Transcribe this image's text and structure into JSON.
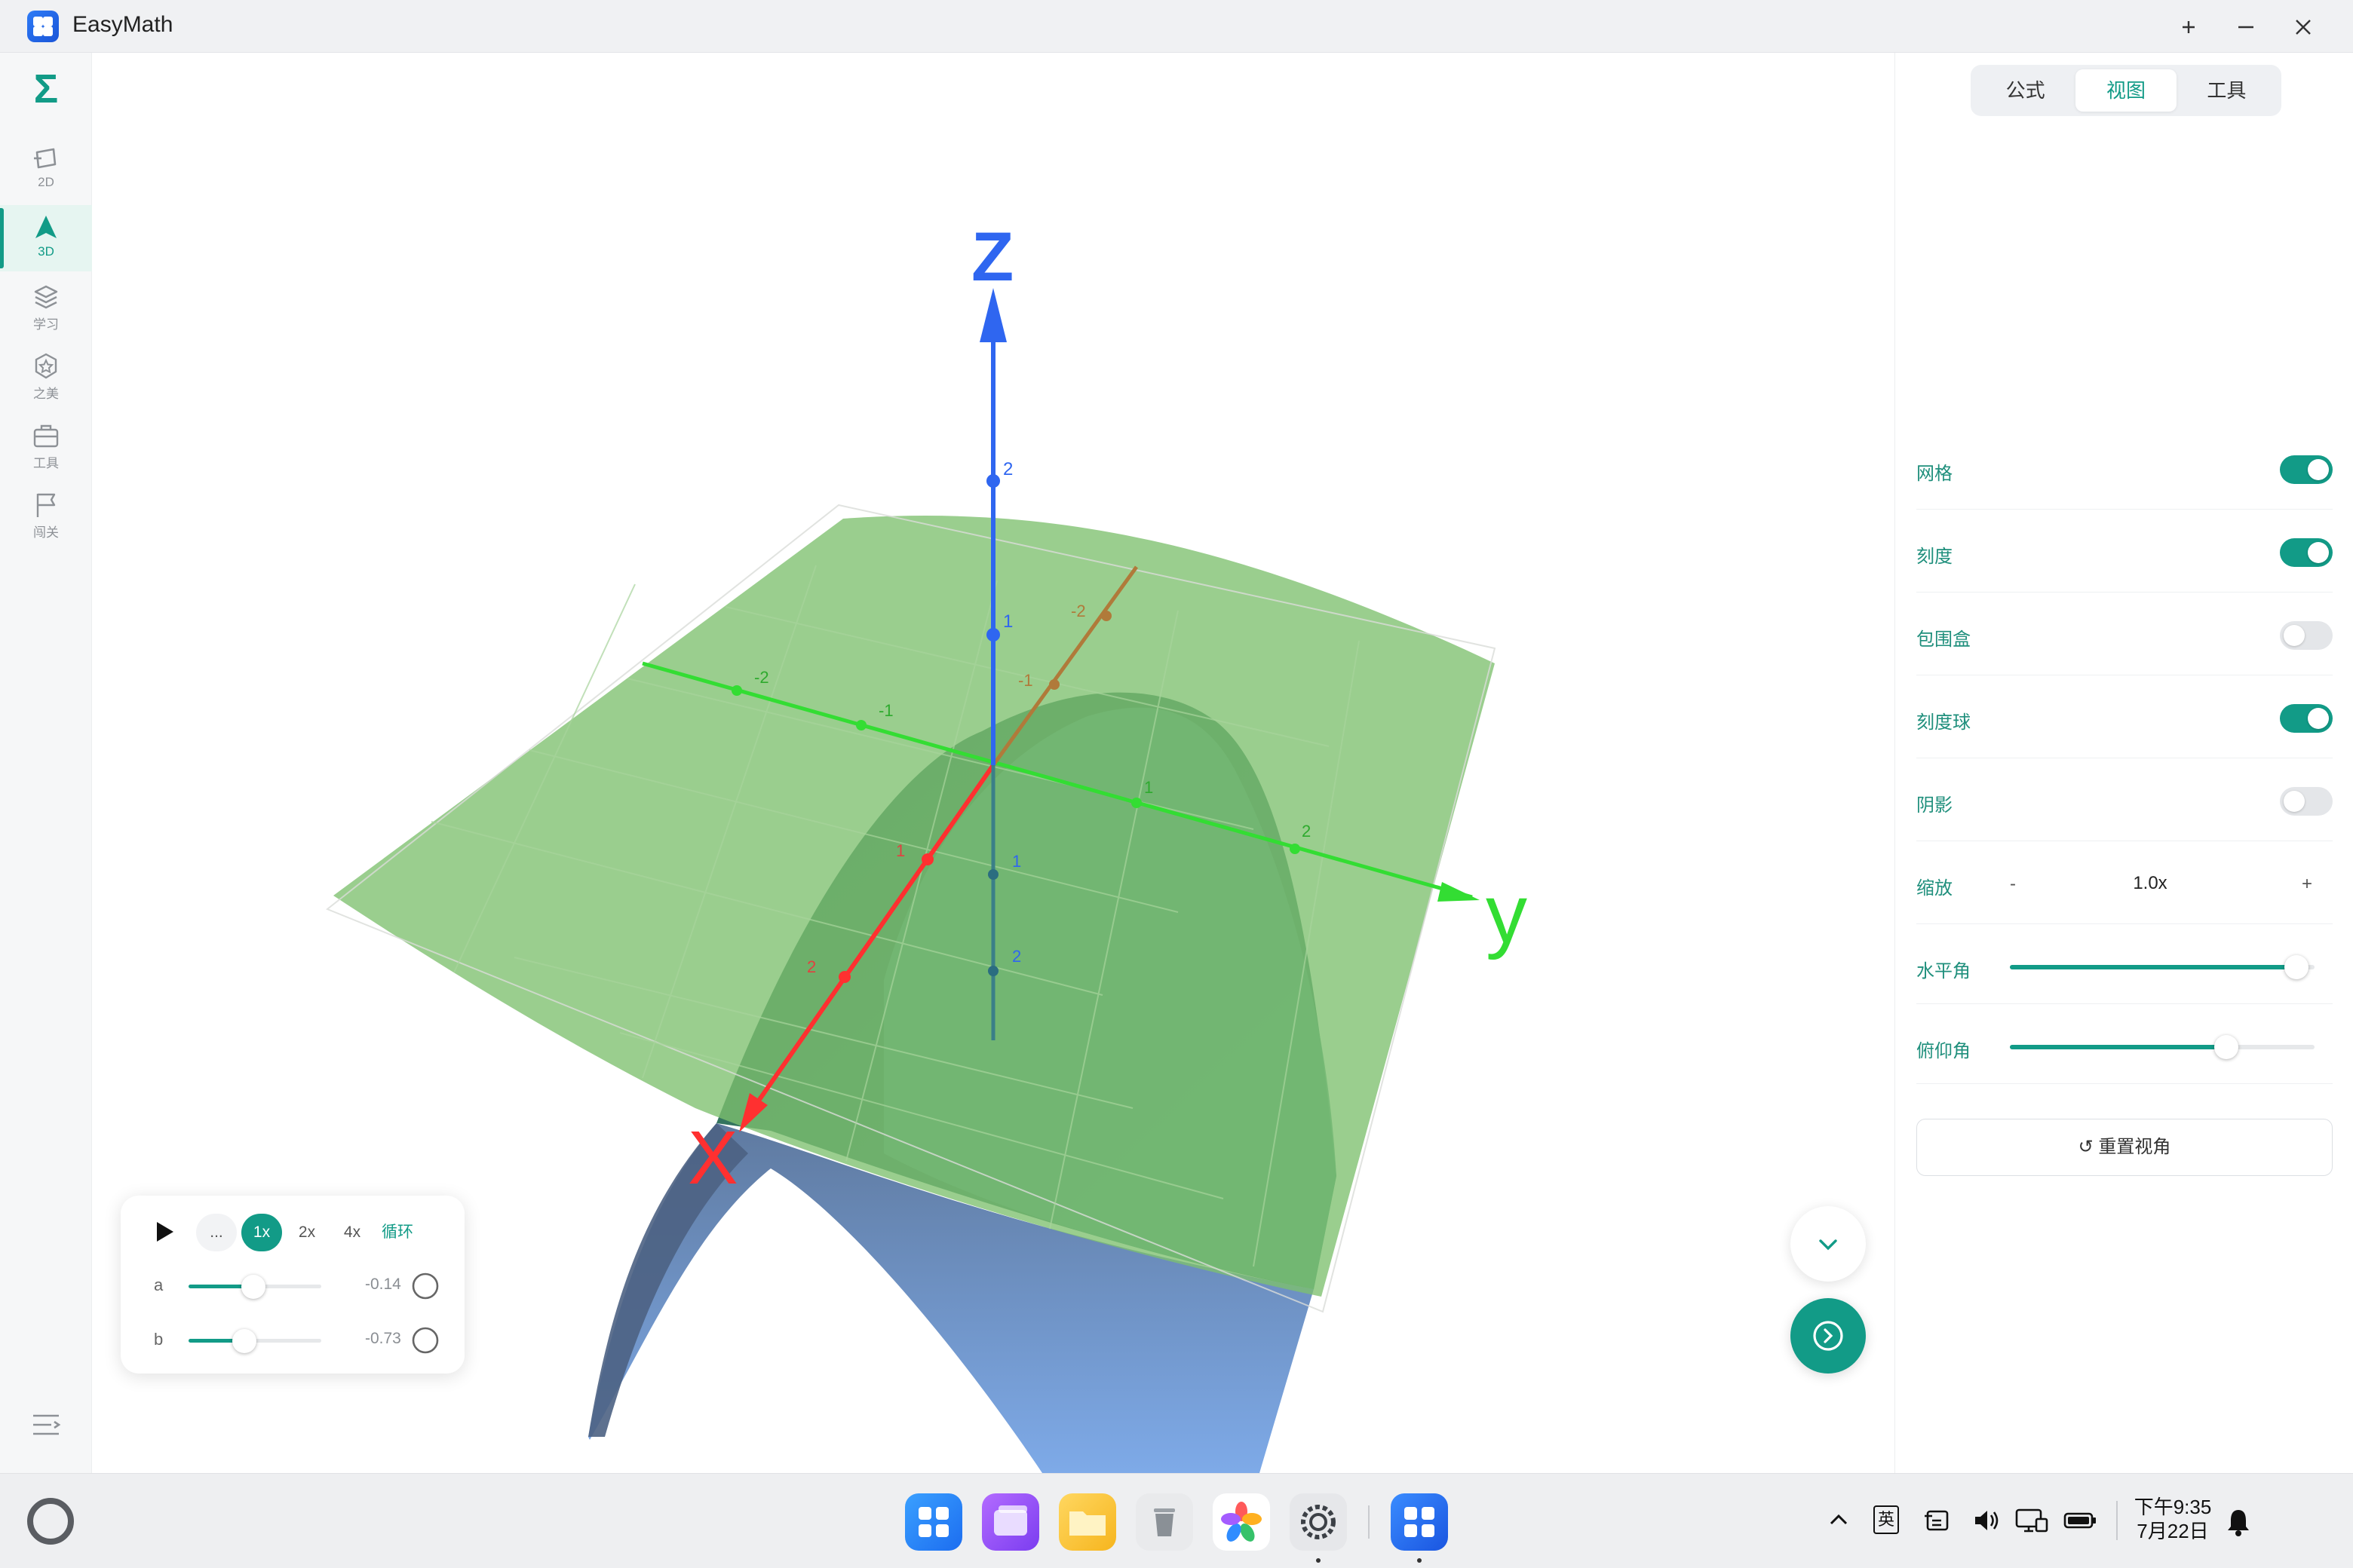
{
  "window": {
    "title": "EasyMath"
  },
  "rail": {
    "items": [
      {
        "label": "2D",
        "icon": "2d-plane-icon"
      },
      {
        "label": "3D",
        "icon": "3d-pyramid-icon"
      },
      {
        "label": "学习",
        "icon": "layers-icon"
      },
      {
        "label": "之美",
        "icon": "star-badge-icon"
      },
      {
        "label": "工具",
        "icon": "toolbox-icon"
      },
      {
        "label": "闯关",
        "icon": "flag-icon"
      }
    ],
    "active_index": 1
  },
  "scene": {
    "axes": {
      "x_label": "X",
      "y_label": "y",
      "z_label": "Z",
      "x_color": "#ff3030",
      "y_color": "#33dd33",
      "z_color": "#2f66f0",
      "z_ticks": [
        "2",
        "1",
        "1",
        "2"
      ],
      "x_ticks": [
        "1",
        "2",
        "-1",
        "-2"
      ],
      "y_ticks": [
        "-2",
        "-1",
        "1",
        "2"
      ]
    },
    "surface_colors": {
      "plane": "#7fbf70",
      "saddle_top": "#3f8a78",
      "saddle_bottom": "#7fa8e6"
    }
  },
  "animation": {
    "play_icon": "play-icon",
    "speeds": [
      "...",
      "1x",
      "2x",
      "4x"
    ],
    "active_speed": 1,
    "loop_label": "循环",
    "params": [
      {
        "name": "a",
        "value": "-0.14",
        "fraction": 0.49
      },
      {
        "name": "b",
        "value": "-0.73",
        "fraction": 0.42
      }
    ]
  },
  "panel": {
    "tabs": [
      "公式",
      "视图",
      "工具"
    ],
    "active_tab": 1,
    "toggles": [
      {
        "label": "网格",
        "on": true
      },
      {
        "label": "刻度",
        "on": true
      },
      {
        "label": "包围盒",
        "on": false
      },
      {
        "label": "刻度球",
        "on": true
      },
      {
        "label": "阴影",
        "on": false
      }
    ],
    "zoom": {
      "label": "缩放",
      "minus": "-",
      "value": "1.0x",
      "plus": "+"
    },
    "sliders": [
      {
        "label": "水平角",
        "fraction": 0.94
      },
      {
        "label": "俯仰角",
        "fraction": 0.71
      }
    ],
    "reset_label": "↺ 重置视角"
  },
  "taskbar": {
    "tray": {
      "ime": "英"
    },
    "clock_time": "下午9:35",
    "clock_date": "7月22日"
  },
  "accent": "#129b87"
}
